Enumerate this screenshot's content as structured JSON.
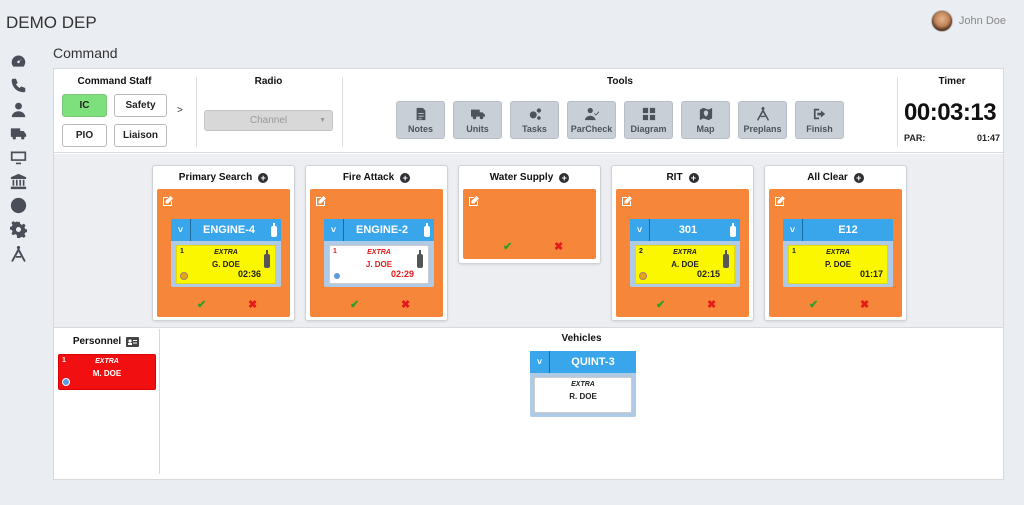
{
  "app": {
    "brand": "DEMO DEP",
    "user_name": "John Doe",
    "page_title": "Command"
  },
  "sidebar": {
    "items": [
      "dashboard-icon",
      "phone-icon",
      "user-icon",
      "truck-icon",
      "monitor-icon",
      "building-icon",
      "clock-icon",
      "gear-icon",
      "compass-icon"
    ]
  },
  "command_staff": {
    "title": "Command Staff",
    "buttons": [
      "IC",
      "Safety",
      "PIO",
      "Liaison"
    ],
    "active": "IC",
    "more": ">"
  },
  "radio": {
    "title": "Radio",
    "channel_placeholder": "Channel"
  },
  "tools": {
    "title": "Tools",
    "items": [
      "Notes",
      "Units",
      "Tasks",
      "ParCheck",
      "Diagram",
      "Map",
      "Preplans",
      "Finish"
    ]
  },
  "timer": {
    "title": "Timer",
    "value": "00:03:13",
    "par_label": "PAR:",
    "par_value": "01:47"
  },
  "groups": [
    {
      "name": "Primary Search",
      "unit": "ENGINE-4",
      "card": {
        "num": "1",
        "extra": "EXTRA",
        "name": "G. DOE",
        "time": "02:36",
        "color": "yellow",
        "badge": "orange"
      }
    },
    {
      "name": "Fire Attack",
      "unit": "ENGINE-2",
      "card": {
        "num": "1",
        "extra": "EXTRA",
        "name": "J. DOE",
        "time": "02:29",
        "color": "white",
        "badge": "blue"
      }
    },
    {
      "name": "Water Supply"
    },
    {
      "name": "RIT",
      "unit": "301",
      "card": {
        "num": "2",
        "extra": "EXTRA",
        "name": "A. DOE",
        "time": "02:15",
        "color": "yellow",
        "badge": "orange"
      }
    },
    {
      "name": "All Clear",
      "unit": "E12",
      "card": {
        "num": "1",
        "extra": "EXTRA",
        "name": "P. DOE",
        "time": "01:17",
        "color": "yellow"
      }
    }
  ],
  "personnel": {
    "title": "Personnel",
    "card": {
      "num": "1",
      "extra": "EXTRA",
      "name": "M. DOE"
    }
  },
  "vehicles": {
    "title": "Vehicles",
    "unit": "QUINT-3",
    "card": {
      "extra": "EXTRA",
      "name": "R. DOE"
    }
  },
  "icons": {
    "confirm": "✔",
    "cancel": "✖",
    "chevron": "˅"
  },
  "colors": {
    "accent_orange": "#f6863a",
    "unit_blue": "#39a6ec",
    "active_green": "#7ee07c",
    "card_yellow": "#fbf700",
    "card_red": "#f20f12"
  }
}
